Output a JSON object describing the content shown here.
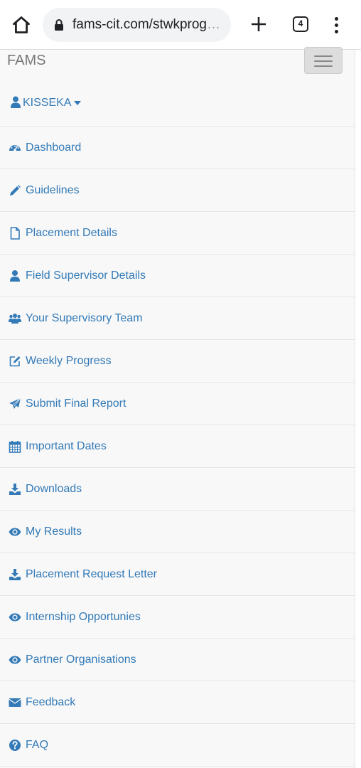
{
  "browser": {
    "url": "fams-cit.com/stwkprog",
    "url_ellipsis": "…",
    "tab_count": "4"
  },
  "navbar": {
    "brand": "FAMS",
    "user_label": "KISSEKA",
    "items": [
      {
        "label": "Dashboard",
        "icon": "dashboard-icon"
      },
      {
        "label": "Guidelines",
        "icon": "pencil-icon"
      },
      {
        "label": "Placement Details",
        "icon": "file-icon"
      },
      {
        "label": "Field Supervisor Details",
        "icon": "user-icon"
      },
      {
        "label": "Your Supervisory Team",
        "icon": "users-icon"
      },
      {
        "label": "Weekly Progress",
        "icon": "edit-icon"
      },
      {
        "label": "Submit Final Report",
        "icon": "paper-plane-icon"
      },
      {
        "label": "Important Dates",
        "icon": "calendar-icon"
      },
      {
        "label": "Downloads",
        "icon": "download-icon"
      },
      {
        "label": "My Results",
        "icon": "eye-icon"
      },
      {
        "label": "Placement Request Letter",
        "icon": "download-icon"
      },
      {
        "label": "Internship Opportunies",
        "icon": "eye-icon"
      },
      {
        "label": "Partner Organisations",
        "icon": "eye-icon"
      },
      {
        "label": "Feedback",
        "icon": "envelope-icon"
      },
      {
        "label": "FAQ",
        "icon": "question-circle-icon"
      }
    ]
  },
  "colors": {
    "link": "#337ab7",
    "brand_text": "#777777",
    "navbar_bg": "#f8f8f8",
    "border": "#e7e7e7"
  }
}
